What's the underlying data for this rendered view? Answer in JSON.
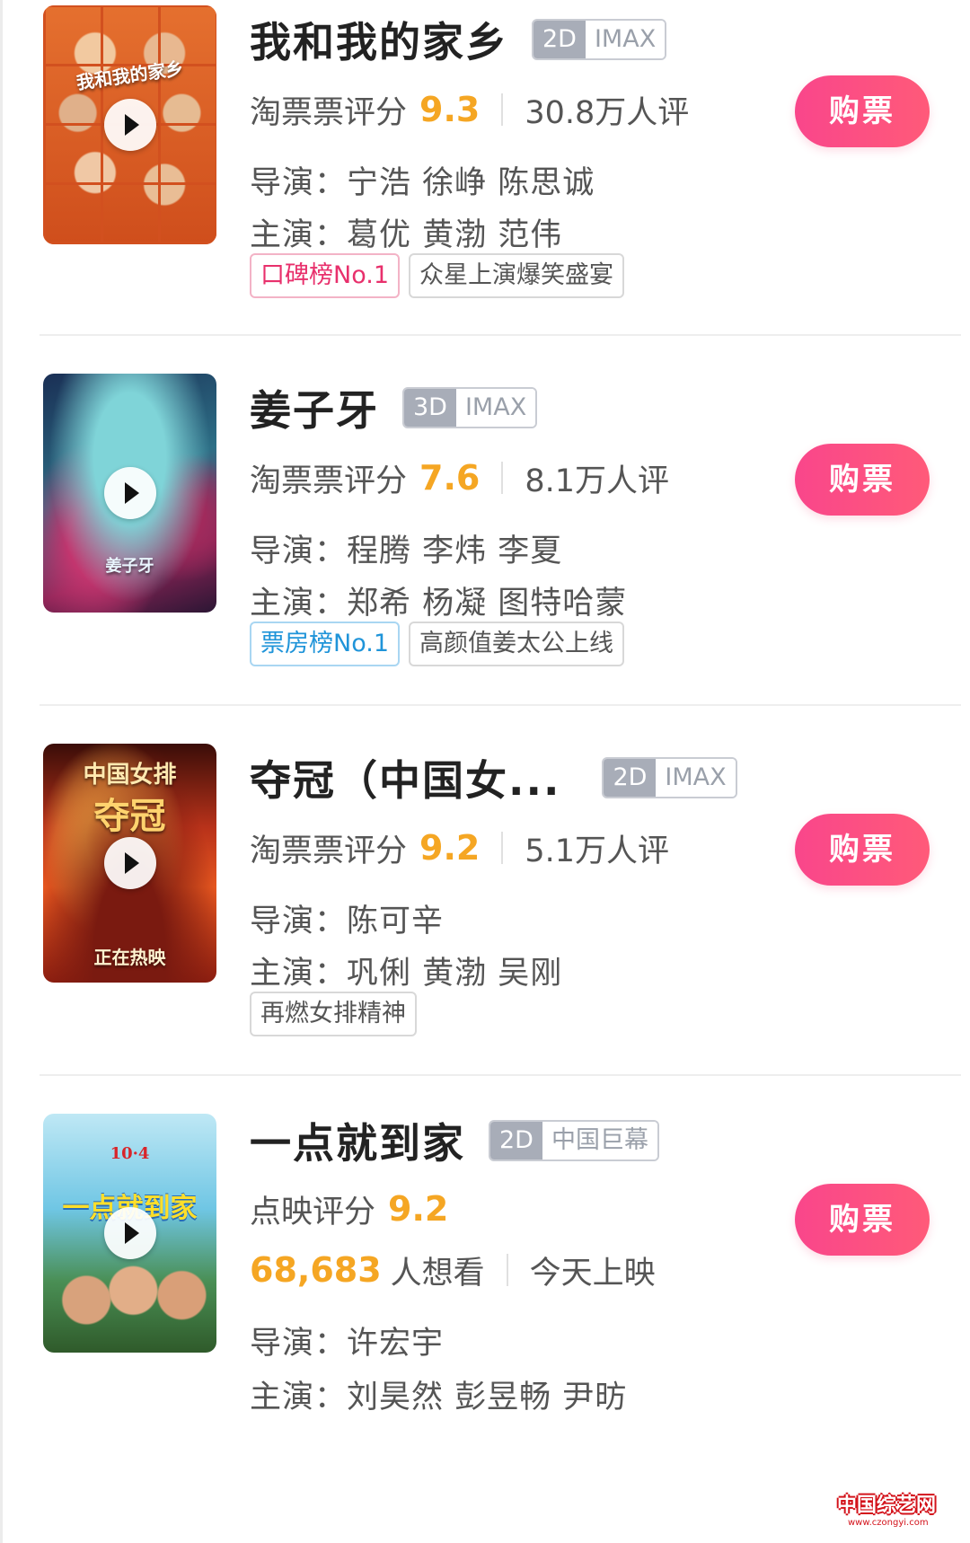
{
  "movies": [
    {
      "title": "我和我的家乡",
      "format_dim": "2D",
      "format_type": "IMAX",
      "rating_label": "淘票票评分",
      "score": "9.3",
      "reviews": "30.8万人评",
      "director": "导演：宁浩 徐峥 陈思诚",
      "cast": "主演：葛优 黄渤 范伟",
      "tags": [
        "口碑榜No.1",
        "众星上演爆笑盛宴"
      ],
      "buy_label": "购票",
      "poster_caption": "我和我的家乡"
    },
    {
      "title": "姜子牙",
      "format_dim": "3D",
      "format_type": "IMAX",
      "rating_label": "淘票票评分",
      "score": "7.6",
      "reviews": "8.1万人评",
      "director": "导演：程腾 李炜 李夏",
      "cast": "主演：郑希 杨凝 图特哈蒙",
      "tags": [
        "票房榜No.1",
        "高颜值姜太公上线"
      ],
      "buy_label": "购票",
      "poster_caption": "姜子牙"
    },
    {
      "title": "夺冠（中国女...",
      "format_dim": "2D",
      "format_type": "IMAX",
      "rating_label": "淘票票评分",
      "score": "9.2",
      "reviews": "5.1万人评",
      "director": "导演：陈可辛",
      "cast": "主演：巩俐 黄渤 吴刚",
      "tags": [
        "再燃女排精神"
      ],
      "buy_label": "购票",
      "poster_caption_top": "中国女排",
      "poster_caption_mid": "夺冠",
      "poster_caption_bottom": "正在热映"
    },
    {
      "title": "一点就到家",
      "format_dim": "2D",
      "format_type": "中国巨幕",
      "rating_label": "点映评分",
      "score": "9.2",
      "want_count": "68,683",
      "want_label": "人想看",
      "release": "今天上映",
      "director": "导演：许宏宇",
      "cast": "主演：刘昊然 彭昱畅 尹昉",
      "buy_label": "购票",
      "poster_caption_top": "10·4",
      "poster_caption_mid": "一点就到家"
    }
  ],
  "watermark": {
    "text": "中国综艺网",
    "url": "www.czongyi.com"
  }
}
